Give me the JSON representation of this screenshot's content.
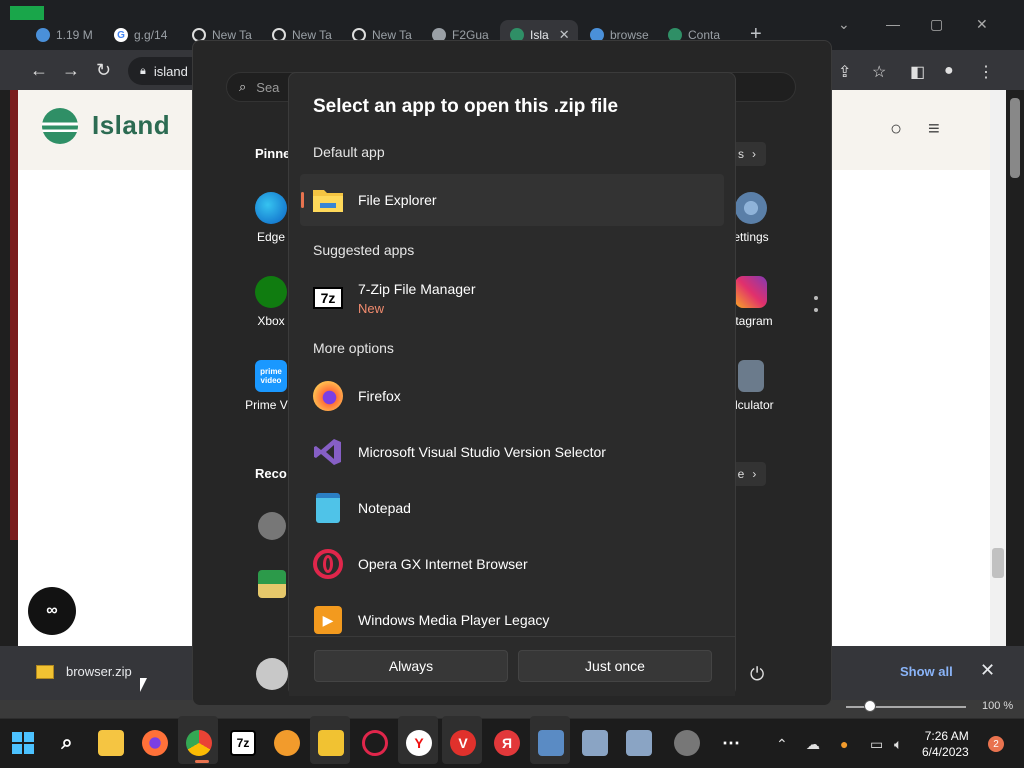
{
  "browser": {
    "tabs": [
      {
        "label": "1.19 M",
        "color": "#4a90d9"
      },
      {
        "label": "g.g/14",
        "color": "#ffffff"
      },
      {
        "label": "New Ta",
        "color": "#ffffff"
      },
      {
        "label": "New Ta",
        "color": "#ffffff"
      },
      {
        "label": "New Ta",
        "color": "#ffffff"
      },
      {
        "label": "F2Gua",
        "color": "#9aa0a6"
      },
      {
        "label": "Isla",
        "color": "#2f8f66"
      },
      {
        "label": "browse",
        "color": "#4a90d9"
      },
      {
        "label": "Conta",
        "color": "#2f8f66"
      }
    ],
    "url": "island",
    "page": {
      "brand": "Island"
    },
    "downloads": {
      "file": "browser.zip",
      "show_all": "Show all"
    },
    "zoom": "100 %"
  },
  "start_menu": {
    "search_placeholder": "Sea",
    "pinned_label": "Pinne",
    "recommended_label": "Reco",
    "pinned_left": [
      "Edge",
      "Xbox",
      "Prime Vid"
    ],
    "pinned_right": [
      "ettings",
      "stagram",
      "alculator"
    ],
    "prime_icon_text": "prime video",
    "all_apps_suffix": "s",
    "more_suffix": "e"
  },
  "dialog": {
    "title": "Select an app to open this .zip file",
    "default_label": "Default app",
    "suggested_label": "Suggested apps",
    "more_label": "More options",
    "default_app": "File Explorer",
    "suggested_app": {
      "name": "7-Zip File Manager",
      "badge": "New",
      "icon_text": "7z"
    },
    "more_apps": [
      "Firefox",
      "Microsoft Visual Studio Version Selector",
      "Notepad",
      "Opera GX Internet Browser",
      "Windows Media Player Legacy"
    ],
    "buttons": {
      "always": "Always",
      "once": "Just once"
    }
  },
  "taskbar": {
    "time": "7:26 AM",
    "date": "6/4/2023",
    "notifications": "2",
    "sevenzip_text": "7z",
    "yandex_text": "Я"
  },
  "colors": {
    "accent": "#e8734f",
    "island_green": "#2c6b52",
    "chrome_link": "#8ab4f8"
  }
}
